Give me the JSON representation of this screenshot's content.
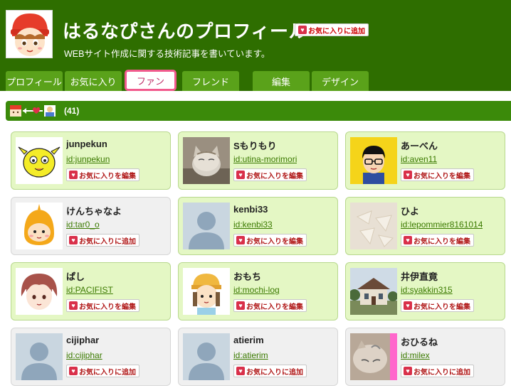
{
  "profile": {
    "title": "はるなぴさんのプロフィール",
    "fav_add_label": "お気に入りに追加",
    "description": "WEBサイト作成に関する技術記事を書いています。"
  },
  "tabs": [
    {
      "label": "プロフィール"
    },
    {
      "label": "お気に入り"
    },
    {
      "label": "ファン",
      "active": true
    },
    {
      "label": "フレンド"
    },
    {
      "label": "編集"
    },
    {
      "label": "デザイン"
    }
  ],
  "fans": {
    "count_label": "(41)"
  },
  "cards": [
    {
      "name": "junpekun",
      "id": "id:junpekun",
      "button": "お気に入りを編集",
      "style": "green"
    },
    {
      "name": "Sもりもり",
      "id": "id:utina-morimori",
      "button": "お気に入りを編集",
      "style": "green"
    },
    {
      "name": "あーべん",
      "id": "id:aven11",
      "button": "お気に入りを編集",
      "style": "green"
    },
    {
      "name": "けんちゃなよ",
      "id": "id:tar0_o",
      "button": "お気に入りに追加",
      "style": "plain"
    },
    {
      "name": "kenbi33",
      "id": "id:kenbi33",
      "button": "お気に入りを編集",
      "style": "green"
    },
    {
      "name": "ひよ",
      "id": "id:lepommier8161014",
      "button": "お気に入りを編集",
      "style": "green"
    },
    {
      "name": "ぱし",
      "id": "id:PACIFIST",
      "button": "お気に入りを編集",
      "style": "green"
    },
    {
      "name": "おもち",
      "id": "id:mochi-log",
      "button": "お気に入りを編集",
      "style": "green"
    },
    {
      "name": "井伊直竟",
      "id": "id:syakkin315",
      "button": "お気に入りを編集",
      "style": "green"
    },
    {
      "name": "cijiphar",
      "id": "id:cijiphar",
      "button": "お気に入りに追加",
      "style": "plain"
    },
    {
      "name": "atierim",
      "id": "id:atierim",
      "button": "お気に入りに追加",
      "style": "plain"
    },
    {
      "name": "おひるね",
      "id": "id:milex",
      "button": "お気に入りに追加",
      "style": "plain"
    }
  ]
}
